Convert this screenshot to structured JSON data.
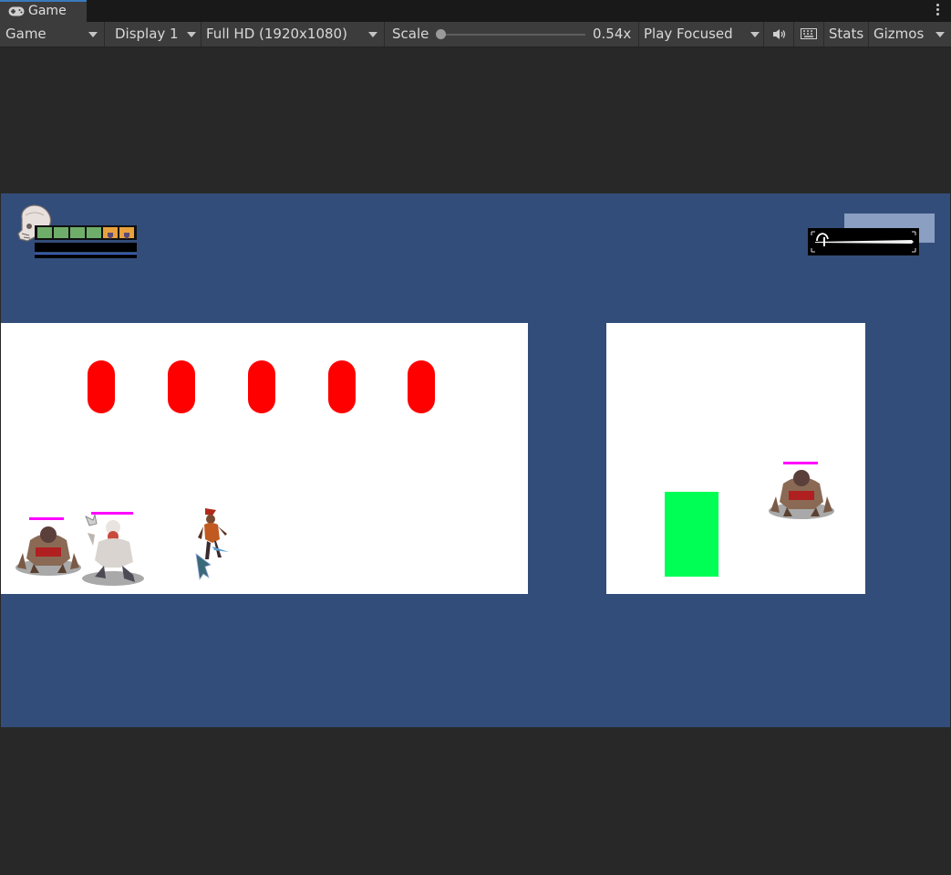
{
  "window": {
    "tab_label": "Game",
    "tab_icon": "gamepad-icon",
    "menu_icon": "kebab-menu-icon"
  },
  "toolbar": {
    "view_mode": "Game",
    "display": "Display 1",
    "resolution": "Full HD (1920x1080)",
    "scale_label": "Scale",
    "scale_value": "0.54x",
    "scale_level": 0.0,
    "play_mode": "Play Focused",
    "audio_icon": "speaker-icon",
    "keyboard_icon": "keyboard-icon",
    "stats_label": "Stats",
    "gizmos_label": "Gizmos"
  },
  "game": {
    "background_color": "#324d7a",
    "hud": {
      "portrait_icon": "skull-icon",
      "health_cells": [
        {
          "state": "filled",
          "color": "#6fae6a"
        },
        {
          "state": "filled",
          "color": "#6fae6a"
        },
        {
          "state": "filled",
          "color": "#6fae6a"
        },
        {
          "state": "filled",
          "color": "#6fae6a"
        },
        {
          "state": "shield",
          "color": "#e9a23d"
        },
        {
          "state": "shield",
          "color": "#e9a23d"
        }
      ],
      "weapon_icon": "sword-icon"
    },
    "hazard_color": "#ff0000",
    "exit_color": "#00ff55",
    "enemy_health_color": "#ff00ff"
  }
}
